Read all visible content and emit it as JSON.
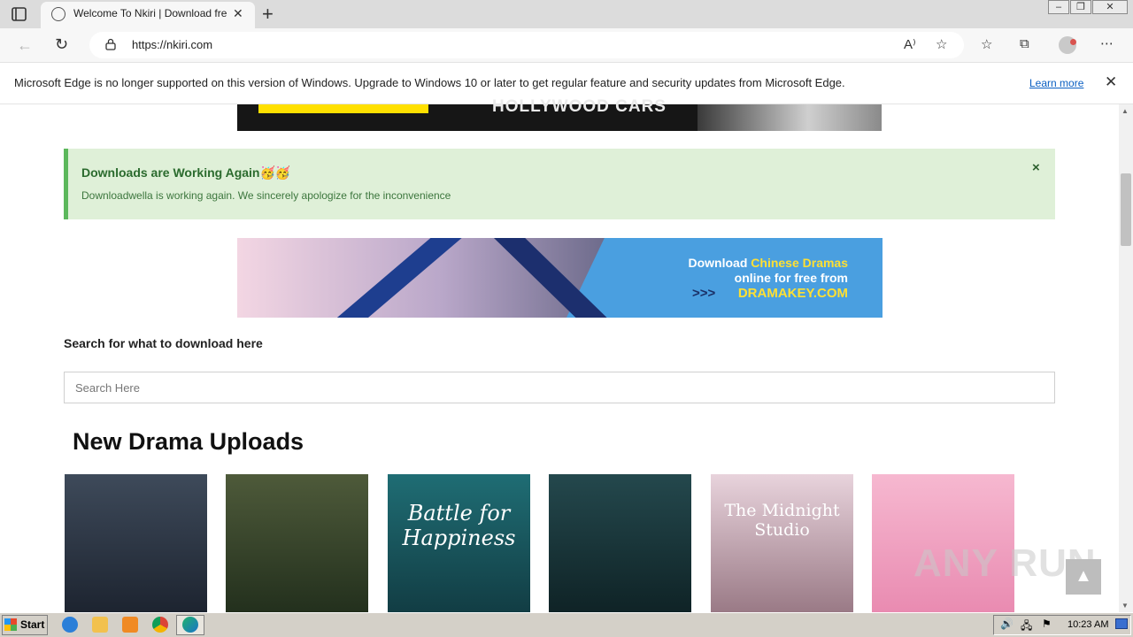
{
  "browser": {
    "tab_title": "Welcome To Nkiri | Download fre",
    "url": "https://nkiri.com",
    "new_tab_glyph": "+",
    "close_glyph": "✕"
  },
  "infobar": {
    "message": "Microsoft Edge is no longer supported on this version of Windows. Upgrade to Windows 10 or later to get regular feature and security updates from Microsoft Edge.",
    "learn_more": "Learn more"
  },
  "page": {
    "top_banner_text": "HOLLYWOOD CARS",
    "alert": {
      "title": "Downloads are Working Again🥳🥳",
      "body": "Downloadwella is working again. We sincerely apologize for the inconvenience",
      "close": "×"
    },
    "drama_banner": {
      "line1_prefix": "Download ",
      "line1_highlight": "Chinese Dramas",
      "line2": "online for free from",
      "arrows": ">>>",
      "line3": "DRAMAKEY.COM"
    },
    "search": {
      "label": "Search for what to download here",
      "placeholder": "Search Here"
    },
    "section_heading": "New Drama Uploads",
    "posters": [
      {
        "title": ""
      },
      {
        "title": ""
      },
      {
        "title": "Battle for Happiness"
      },
      {
        "title": ""
      },
      {
        "title": "The Midnight Studio"
      },
      {
        "title": ""
      }
    ],
    "watermark": "ANY RUN",
    "back_to_top": "▲"
  },
  "taskbar": {
    "start_label": "Start",
    "clock": "10:23 AM"
  },
  "colors": {
    "alert_bg": "#dff0d8",
    "alert_border": "#5cb85c",
    "link": "#0a5fc2",
    "banner_blue": "#4a9fe0",
    "banner_yellow": "#ffe033"
  }
}
